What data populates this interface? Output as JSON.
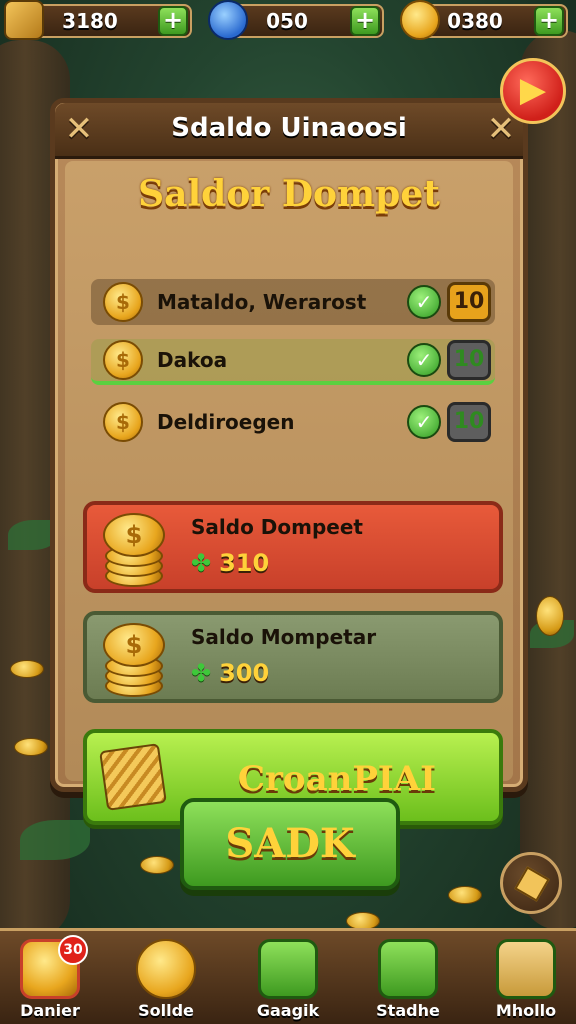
{
  "top_bar": {
    "resource_1": {
      "value": "3180",
      "plus": "+"
    },
    "resource_2": {
      "value": "050",
      "plus": "+"
    },
    "resource_3": {
      "value": "0380",
      "plus": "+"
    },
    "icons": [
      "arrow-icon",
      "gem-icon",
      "coin-icon"
    ]
  },
  "close_button": {
    "glyph": "▶"
  },
  "panel": {
    "header_title": "Sdaldo Uinaoosi",
    "corner_glyph": "✕",
    "title": "Saldor Dompet",
    "rows": [
      {
        "label": "Mataldo, Werarost",
        "check": "✓",
        "value": "10",
        "style": "gold"
      },
      {
        "label": "Dakoa",
        "check": "✓",
        "value": "10",
        "style": "grey"
      },
      {
        "label": "Deldiroegen",
        "check": "✓",
        "value": "10",
        "style": "grey"
      }
    ],
    "cards": [
      {
        "title": "Saldo Dompeet",
        "value": "310",
        "color": "#d84a30"
      },
      {
        "title": "Saldo Mompetar",
        "value": "300",
        "color": "#7c8c60"
      }
    ],
    "confirm_button": {
      "label": "CroanPIAI"
    }
  },
  "main_button": {
    "label": "SADK"
  },
  "bottom_nav": [
    {
      "label": "Danier",
      "icon": "coin-icon",
      "badge": "30"
    },
    {
      "label": "Sollde",
      "icon": "coin-icon"
    },
    {
      "label": "Gaagik",
      "icon": "coin-bag-icon"
    },
    {
      "label": "Stadhe",
      "icon": "coin-stack-icon"
    },
    {
      "label": "Mhollo",
      "icon": "treasure-box-icon"
    }
  ],
  "colors": {
    "gold": "#ffd23a",
    "green": "#5bd040",
    "red": "#d84a30",
    "wood": "#5a3a1e"
  }
}
